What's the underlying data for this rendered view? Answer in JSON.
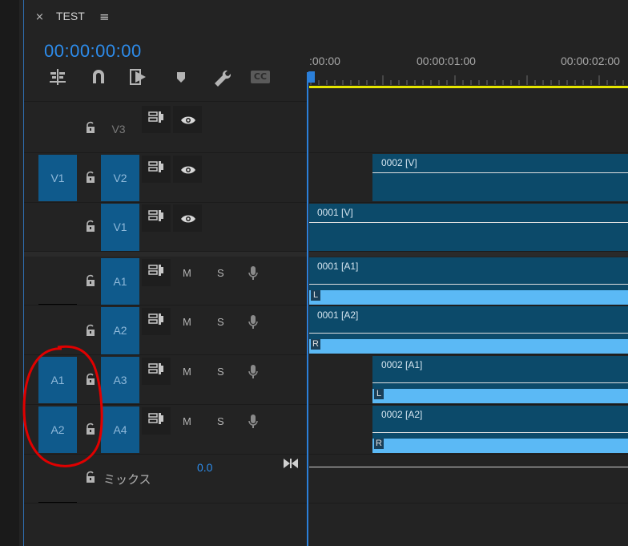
{
  "panel": {
    "tab_close": "×",
    "tab_title": "TEST",
    "tab_menu": "≡",
    "timecode": "00:00:00:00"
  },
  "toolbar": {
    "icons": [
      "insert-overwrite-icon",
      "snap-icon",
      "linked-selection-icon",
      "add-marker-icon",
      "settings-wrench-icon",
      "captions-icon"
    ],
    "cc_label": "CC"
  },
  "ruler": {
    "labels": [
      ":00:00",
      "00:00:01:00",
      "00:00:02:00"
    ]
  },
  "tracks": {
    "V3": {
      "target": "V3",
      "source": ""
    },
    "V2": {
      "target": "V2",
      "source": "V1"
    },
    "V1": {
      "target": "V1",
      "source": ""
    },
    "A1": {
      "target": "A1",
      "source": "",
      "m": "M",
      "s": "S"
    },
    "A2": {
      "target": "A2",
      "source": "",
      "m": "M",
      "s": "S"
    },
    "A3": {
      "target": "A3",
      "source": "A1",
      "m": "M",
      "s": "S"
    },
    "A4": {
      "target": "A4",
      "source": "A2",
      "m": "M",
      "s": "S"
    }
  },
  "mix": {
    "label": "ミックス",
    "value": "0.0"
  },
  "clips": {
    "v2": "0002 [V]",
    "v1": "0001 [V]",
    "a1": "0001 [A1]",
    "a2": "0001 [A2]",
    "a3": "0002 [A1]",
    "a4": "0002 [A2]",
    "chan_L": "L",
    "chan_R": "R"
  },
  "colors": {
    "accent": "#2b7fd9",
    "patch": "#0f5a8c",
    "clip": "#0c4a6a",
    "audio": "#5bb9f5",
    "workarea": "#e6e600",
    "annotation": "#e00000"
  }
}
